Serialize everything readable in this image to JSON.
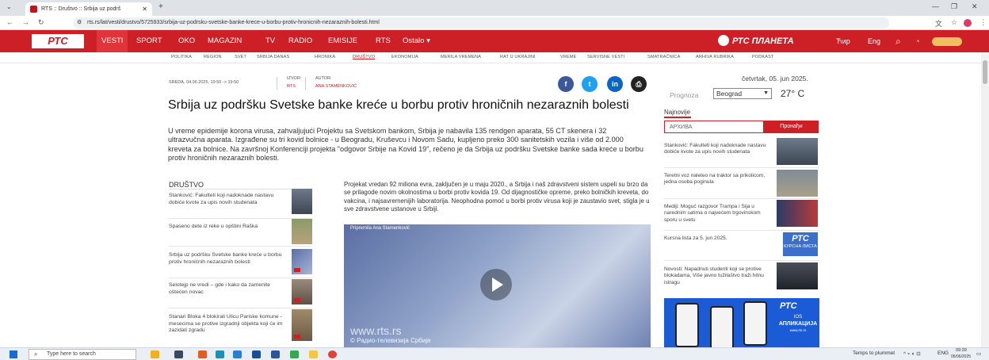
{
  "browser": {
    "tab_title": "RTS :: Društvo :: Srbija uz podrš",
    "tab_close": "✕",
    "new_tab": "+",
    "url": "rts.rs/lat/vesti/drustvo/5725933/srbija-uz-podrsku-svetske-banke-krece-u-borbu-protiv-hronicnih-nezaraznih-bolesti.html"
  },
  "header": {
    "logo": "РТС",
    "nav": [
      "VESTI",
      "SPORT",
      "OKO",
      "MAGAZIN",
      "TV",
      "RADIO",
      "EMISIJE",
      "RTS",
      "Ostalo ▾"
    ],
    "active_nav": "VESTI",
    "planeta": "РТС ПЛАНЕТА",
    "lang_cyr": "Ћир",
    "lang_eng": "Eng"
  },
  "subnav": [
    "POLITIKA",
    "REGION",
    "SVET",
    "SRBIJA DANAS",
    "HRONIKA",
    "DRUŠTVO",
    "EKONOMIJA",
    "MERILA VREMENA",
    "RAT U UKRAJINI",
    "VREME",
    "SERVISNE VESTI",
    "SMATRAČNICA",
    "ARHIVA RUBRIKA",
    "PODKAST"
  ],
  "article": {
    "date": "SREDA, 04.06.2025, 19:50 -> 19:50",
    "source_label": "IZVOR:",
    "source": "RTS",
    "author_label": "AUTOR:",
    "author": "ANA STAMENKOVIĆ",
    "title": "Srbija uz podršku Svetske banke kreće u borbu protiv hroničnih nezaraznih bolesti",
    "lead": "U vreme epidemije korona virusa, zahvaljujući Projektu sa Svetskom bankom, Srbija je nabavila 135 rendgen aparata, 55 CT skenera i 32 ultrazvučna aparata. Izgrađene su tri kovid bolnice - u Beogradu, Kruševcu i Novom Sadu, kupljeno preko 300 sanitetskih vozila i više od 2.000 kreveta za bolnice. Na završnoj Konferenciji projekta \"odgovor Srbije na Kovid 19\", rečeno je da Srbija uz podršku Svetske banke sada kreće u borbu protiv hroničnih nezaraznih bolesti.",
    "body": "Projekat vredan 92 miliona evra, zaključen je u maju 2020., a Srbija i naš zdravstveni sistem uspeli su brzo da se prilagode novim okolnostima u borbi protiv kovida 19. Od dijagnostičke opreme, preko bolničkih kreveta, do vakcina, i najsavremenijih laboratorija. Neophodna pomoć u borbi protiv virusa koji je zaustavio svet, stigla je u sve zdravstvene ustanove u Srbiji.",
    "video_caption": "Pripremila Ana Stamenković",
    "watermark1": "www.rts.rs",
    "watermark2": "© Радио-телевизија Србије"
  },
  "related": {
    "section": "DRUŠTVO",
    "items": [
      "Stanković: Fakulteti koji nadoknade nastavu dobiće kvote za upis novih studenata",
      "Spaseno dete iz reke u opštini Raška",
      "Srbija uz podršku Svetske banke kreće u borbu protiv hroničnih nezaraznih bolesti",
      "Selotejp ne vredi – gde i kako da zamenite oštećen novac",
      "Stanari Bloka 4 blokirali Ulicu Pariske komune - mesecima se protive izgradnji objekta koji će im zazidati zgradu"
    ]
  },
  "sidebar": {
    "date": "četvrtak, 05. jun 2025.",
    "weather_label": "Prognoza",
    "city": "Beograd",
    "temperature": "27° C",
    "latest_label": "Najnovije",
    "search_placeholder": "АРХИВА",
    "search_button": "Пронађи",
    "items": [
      "Stanković: Fakulteti koji nadoknade nastavu dobiće kvote za upis novih studenata",
      "Teretni voz naleteo na traktor sa prikolicom, jedna osoba poginula",
      "Mediji: Moguć razgovor Trampa i Sija u narednim satima o najvećem trgovinskom sporu u svetu",
      "Kursna lista za 5. jun 2025.",
      "Novosti: Napadnuti studenti koji se protive blokadama, Više javno tužilaštvo traži hitnu istragu"
    ],
    "rtc_box": "РТС",
    "rtc_box_sub": "КУРСНА ЛИСТА",
    "app_logo": "РТС",
    "app_ios": "IOS",
    "app_title": "АПЛИКАЦИЈА",
    "app_url": "www.rts.rs"
  },
  "taskbar": {
    "search": "Type here to search",
    "weather": "Temps to plummet",
    "lang": "ENG",
    "time": "09:39",
    "date": "05/06/2025"
  }
}
